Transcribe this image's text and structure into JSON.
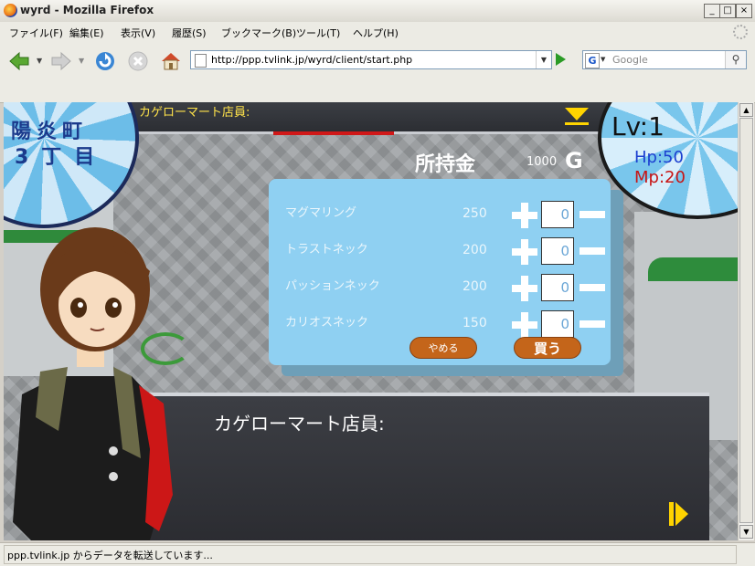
{
  "window": {
    "title": "wyrd - Mozilla Firefox"
  },
  "menu": [
    "ファイル(F)",
    "編集(E)",
    "表示(V)",
    "履歴(S)",
    "ブックマーク(B)",
    "ツール(T)",
    "ヘルプ(H)"
  ],
  "nav": {
    "url": "http://ppp.tvlink.jp/wyrd/client/start.php",
    "search_placeholder": "Google",
    "search_engine_letter": "G"
  },
  "status": {
    "text": "ppp.tvlink.jp からデータを転送しています..."
  },
  "game": {
    "speaker_top": "カゲローマート店員:",
    "location_line1": "陽炎町",
    "location_line2": "3丁目",
    "level": "Lv:1",
    "hp": "Hp:50",
    "mp": "Mp:20",
    "money_label": "所持金",
    "money_value": "1000",
    "money_unit": "G",
    "items": [
      {
        "name": "マグマリング",
        "price": "250",
        "qty": "0"
      },
      {
        "name": "トラストネック",
        "price": "200",
        "qty": "0"
      },
      {
        "name": "パッションネック",
        "price": "200",
        "qty": "0"
      },
      {
        "name": "カリオスネック",
        "price": "150",
        "qty": "0"
      }
    ],
    "cancel_label": "やめる",
    "buy_label": "買う",
    "dialog_speaker": "カゲローマート店員:"
  }
}
